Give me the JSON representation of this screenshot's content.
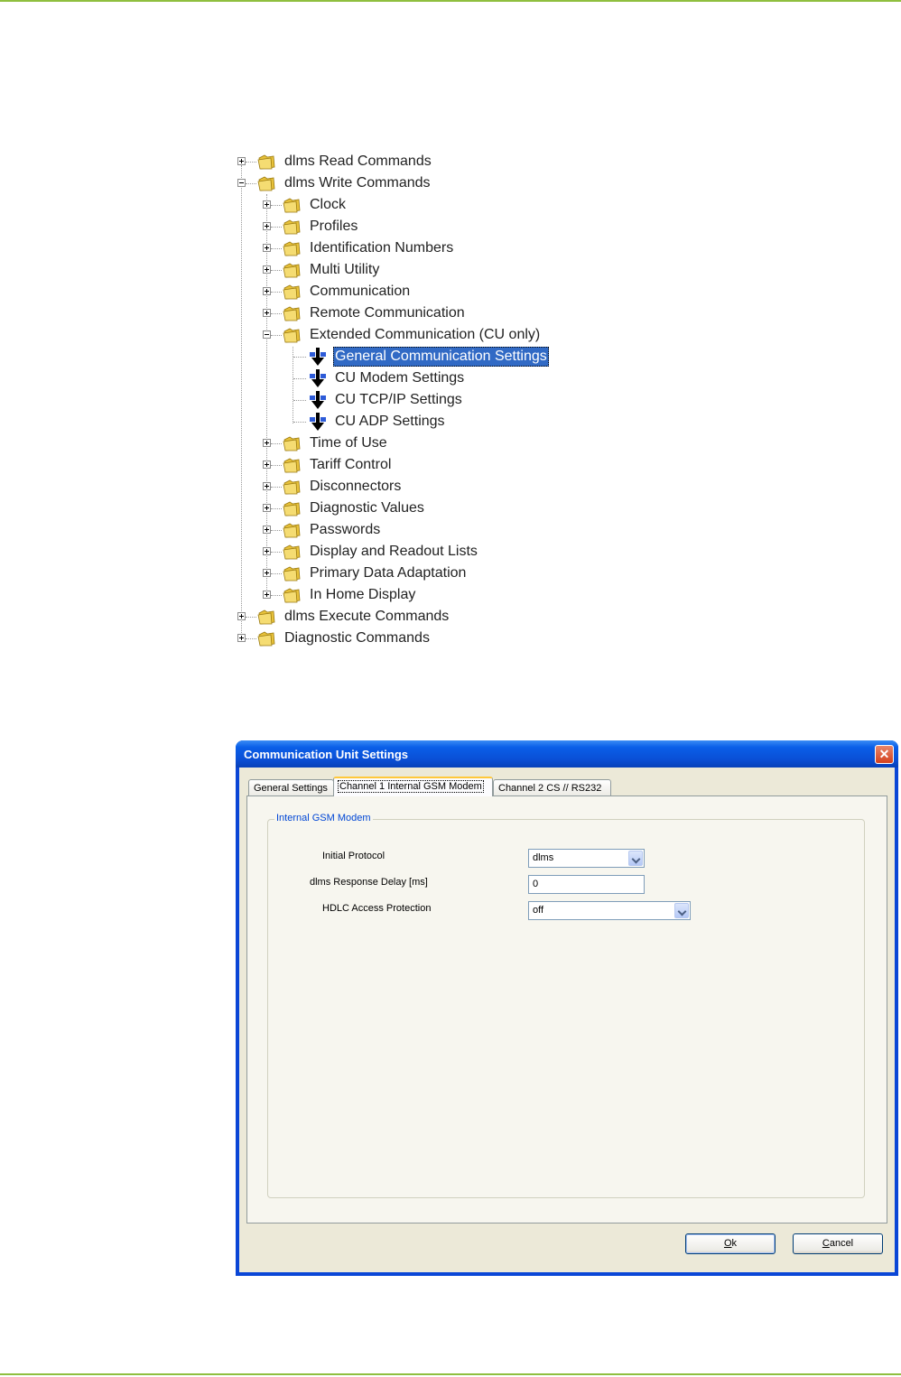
{
  "tree": {
    "root_items": [
      {
        "label": "dlms Read Commands",
        "expanded": false
      },
      {
        "label": "dlms Write Commands",
        "expanded": true
      },
      {
        "label": "dlms Execute Commands",
        "expanded": false
      },
      {
        "label": "Diagnostic Commands",
        "expanded": false
      }
    ],
    "write_children": [
      "Clock",
      "Profiles",
      "Identification Numbers",
      "Multi Utility",
      "Communication",
      "Remote Communication",
      "Extended Communication (CU only)",
      "Time of Use",
      "Tariff Control",
      "Disconnectors",
      "Diagnostic Values",
      "Passwords",
      "Display and Readout Lists",
      "Primary Data Adaptation",
      "In Home Display"
    ],
    "extended_children": [
      "General Communication Settings",
      "CU Modem Settings",
      "CU TCP/IP Settings",
      "CU ADP Settings"
    ],
    "selected": "General Communication Settings"
  },
  "dialog": {
    "title": "Communication Unit Settings",
    "close_glyph": "✕",
    "tabs": [
      "General Settings",
      "Channel 1 Internal GSM Modem",
      "Channel 2 CS // RS232"
    ],
    "active_tab": "Channel 1 Internal GSM Modem",
    "group_title": "Internal GSM Modem",
    "fields": {
      "initial_protocol": {
        "label": "Initial Protocol",
        "value": "dlms"
      },
      "response_delay": {
        "label": "dlms Response Delay [ms]",
        "value": "0"
      },
      "hdlc_protection": {
        "label": "HDLC Access Protection",
        "value": "off"
      }
    },
    "ok_label": "Ok",
    "ok_mnemonic": "O",
    "ok_rest": "k",
    "cancel_label": "Cancel",
    "cancel_mnemonic": "C",
    "cancel_rest": "ancel"
  },
  "colors": {
    "accent_rule": "#8fbf3f",
    "selection": "#316ac5",
    "titlebar": "#0a4fd6",
    "group_title": "#0046d5"
  }
}
